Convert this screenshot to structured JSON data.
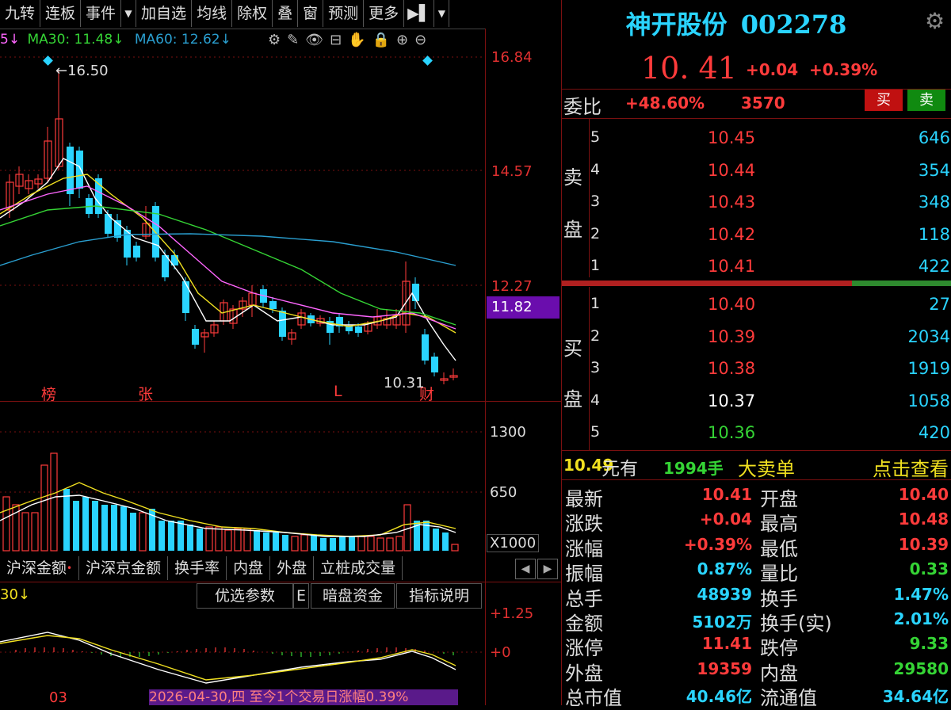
{
  "toolbar": {
    "items": [
      "九转",
      "连板",
      "事件",
      "▼",
      "加自选",
      "均线",
      "除权",
      "叠",
      "窗",
      "预测",
      "更多",
      "▶▌",
      "▼"
    ]
  },
  "ma_legend": {
    "prefix": "5↓",
    "ma30": "MA30: 11.48↓",
    "ma60": "MA60: 12.62↓"
  },
  "price_axis": {
    "labels": [
      "16.84",
      "14.57",
      "12.27",
      "11.82"
    ],
    "current_price_tag": "11.82"
  },
  "chart_annotations": {
    "high": "←16.50",
    "low": "10.31",
    "markers": [
      "榜",
      "张",
      "L",
      "财"
    ]
  },
  "volume_axis": {
    "labels": [
      "1300",
      "650",
      "X1000"
    ]
  },
  "lower_tabs": [
    "沪深金额",
    "沪深京金额",
    "换手率",
    "内盘",
    "外盘",
    "立桩成交量"
  ],
  "indicator": {
    "legend": "30↓",
    "buttons": [
      "优选参数",
      "E",
      "暗盘资金",
      "指标说明"
    ],
    "axis": [
      "+1.25",
      "+0"
    ],
    "date_label": "03",
    "status": "2026-04-30,四 至今1个交易日涨幅0.39%"
  },
  "quote": {
    "name": "神开股份",
    "code": "002278",
    "price": "10. 41",
    "change": "+0.04",
    "change_pct": "+0.39%",
    "weibi_label": "委比",
    "weibi_pct": "+48.60%",
    "weibi_diff": "3570",
    "buy_btn": "买",
    "sell_btn": "卖"
  },
  "sell_orders": [
    {
      "level": "5",
      "price": "10.45",
      "vol": "646"
    },
    {
      "level": "4",
      "price": "10.44",
      "vol": "354"
    },
    {
      "level": "3",
      "price": "10.43",
      "vol": "348"
    },
    {
      "level": "2",
      "price": "10.42",
      "vol": "118"
    },
    {
      "level": "1",
      "price": "10.41",
      "vol": "422"
    }
  ],
  "buy_orders": [
    {
      "level": "1",
      "price": "10.40",
      "vol": "27"
    },
    {
      "level": "2",
      "price": "10.39",
      "vol": "2034"
    },
    {
      "level": "3",
      "price": "10.38",
      "vol": "1919"
    },
    {
      "level": "4",
      "price": "10.37",
      "vol": "1058"
    },
    {
      "level": "5",
      "price": "10.36",
      "vol": "420"
    }
  ],
  "side_labels": {
    "sell1": "卖",
    "sell2": "盘",
    "buy1": "买",
    "buy2": "盘"
  },
  "big_order": {
    "price": "10.49",
    "text1": "元有",
    "qty": "1994手",
    "text2": "大卖单",
    "link": "点击查看"
  },
  "stats": [
    {
      "k1": "最新",
      "v1": "10.41",
      "c1": "red",
      "k2": "开盘",
      "v2": "10.40",
      "c2": "red"
    },
    {
      "k1": "涨跌",
      "v1": "+0.04",
      "c1": "red",
      "k2": "最高",
      "v2": "10.48",
      "c2": "red"
    },
    {
      "k1": "涨幅",
      "v1": "+0.39%",
      "c1": "red",
      "k2": "最低",
      "v2": "10.39",
      "c2": "red"
    },
    {
      "k1": "振幅",
      "v1": "0.87%",
      "c1": "cyan",
      "k2": "量比",
      "v2": "0.33",
      "c2": "green"
    },
    {
      "k1": "总手",
      "v1": "48939",
      "c1": "cyan",
      "k2": "换手",
      "v2": "1.47%",
      "c2": "cyan"
    },
    {
      "k1": "金额",
      "v1": "5102万",
      "c1": "cyan",
      "k2": "换手(实)",
      "v2": "2.01%",
      "c2": "cyan"
    },
    {
      "k1": "涨停",
      "v1": "11.41",
      "c1": "red",
      "k2": "跌停",
      "v2": "9.33",
      "c2": "green"
    },
    {
      "k1": "外盘",
      "v1": "19359",
      "c1": "red",
      "k2": "内盘",
      "v2": "29580",
      "c2": "green"
    },
    {
      "k1": "总市值",
      "v1": "40.46亿",
      "c1": "cyan",
      "k2": "流通值",
      "v2": "34.64亿",
      "c2": "cyan"
    }
  ],
  "colors": {
    "up": "#ff3b3b",
    "down": "#2ad4ff",
    "ma5": "#ffffff",
    "ma10": "#f0e020",
    "ma20": "#ff66ff",
    "ma30": "#35d435",
    "ma60": "#2a9fd0",
    "border": "#7a1010"
  },
  "icons": [
    "gear-icon",
    "eraser-icon",
    "brush-icon",
    "eye-icon",
    "toolbox-icon",
    "hand-icon",
    "lock-icon",
    "zoom-in-icon",
    "zoom-out-icon",
    "settings-icon"
  ]
}
